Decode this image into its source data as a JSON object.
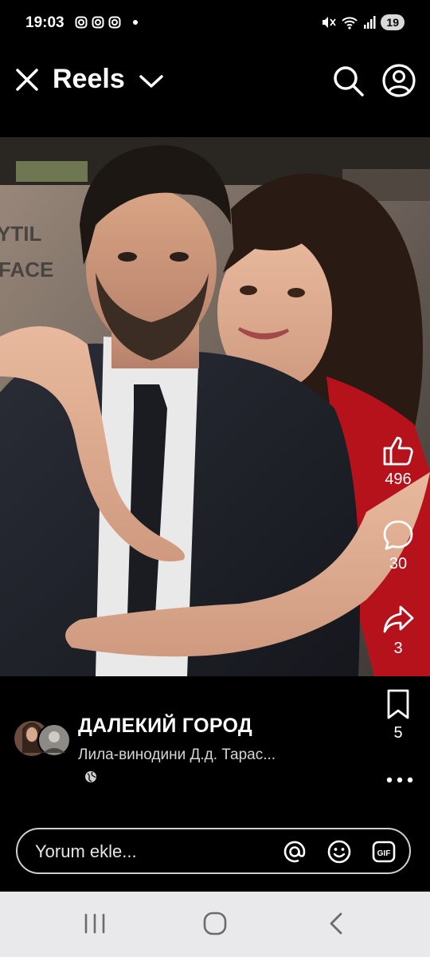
{
  "status_bar": {
    "time": "19:03",
    "battery": "19"
  },
  "header": {
    "title": "Reels"
  },
  "actions": {
    "likes": "496",
    "comments": "30",
    "shares": "3",
    "saves": "5"
  },
  "post": {
    "page_name": "ДАЛЕКИЙ ГОРОД",
    "subtitle": "Лила-винодини Д.д. Тарас..."
  },
  "comment_bar": {
    "placeholder": "Yorum ekle..."
  },
  "colors": {
    "background": "#000000",
    "nav_bar": "#e9e9eb",
    "dress_red": "#b5121b"
  }
}
